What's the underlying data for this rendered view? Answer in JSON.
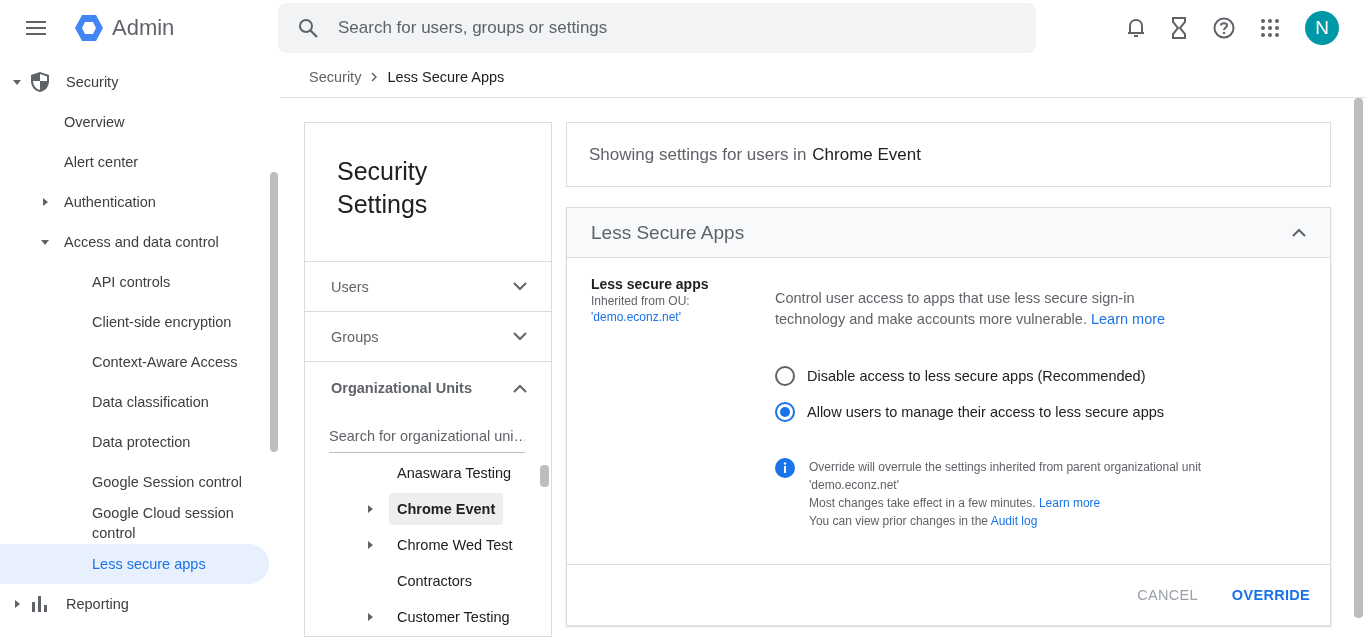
{
  "header": {
    "app_name": "Admin",
    "search": {
      "placeholder": "Search for users, groups or settings"
    },
    "avatar": "N"
  },
  "sidebar": {
    "items": [
      {
        "label": "Security",
        "expanded": true,
        "kind": "shield",
        "children": [
          {
            "label": "Overview",
            "selected": false
          },
          {
            "label": "Alert center",
            "selected": false
          },
          {
            "label": "Authentication",
            "expanded": false,
            "selected": false
          },
          {
            "label": "Access and data control",
            "expanded": true,
            "selected": false,
            "children": [
              {
                "label": "API controls",
                "selected": false
              },
              {
                "label": "Client-side encryption",
                "selected": false
              },
              {
                "label": "Context-Aware Access",
                "selected": false
              },
              {
                "label": "Data classification",
                "selected": false
              },
              {
                "label": "Data protection",
                "selected": false
              },
              {
                "label": "Google Session control",
                "selected": false
              },
              {
                "label": "Google Cloud session control",
                "selected": false
              },
              {
                "label": "Less secure apps",
                "selected": true
              }
            ]
          }
        ],
        "selected": false
      },
      {
        "label": "Reporting",
        "expanded": false,
        "kind": "chart",
        "selected": false
      }
    ]
  },
  "breadcrumb": [
    "Security",
    "Less Secure Apps"
  ],
  "settings_panel": {
    "title": "Security Settings",
    "sections": [
      {
        "label": "Users",
        "expanded": false
      },
      {
        "label": "Groups",
        "expanded": false
      },
      {
        "label": "Organizational Units",
        "expanded": true
      }
    ],
    "ou_search": {
      "placeholder": "Search for organizational uni…"
    },
    "ou_tree": [
      {
        "label": "Anaswara Testing",
        "selected": false
      },
      {
        "label": "Chrome Event",
        "expanded": false,
        "selected": true
      },
      {
        "label": "Chrome Wed Test",
        "expanded": false,
        "selected": false
      },
      {
        "label": "Contractors",
        "selected": false
      },
      {
        "label": "Customer Testing",
        "expanded": false,
        "selected": false
      }
    ]
  },
  "showing": {
    "prefix": "Showing settings for users in",
    "unit": "Chrome Event"
  },
  "card": {
    "title": "Less Secure Apps",
    "expanded": true,
    "setting_name": "Less secure apps",
    "inherited_label": "Inherited from OU:",
    "inherited_link": "'demo.econz.net'",
    "description": "Control user access to apps that use less secure sign-in technology and make accounts more vulnerable.",
    "description_link": "Learn more",
    "options": [
      {
        "label": "Disable access to less secure apps (Recommended)",
        "selected": false
      },
      {
        "label": "Allow users to manage their access to less secure apps",
        "selected": true
      }
    ],
    "info_lines": [
      {
        "text": "Override will overrule the settings inherited from parent organizational unit 'demo.econz.net'"
      },
      {
        "text": "Most changes take effect in a few minutes.",
        "link": "Learn more"
      },
      {
        "text": "You can view prior changes in the",
        "link": "Audit log"
      }
    ],
    "buttons": [
      {
        "label": "CANCEL",
        "disabled": true
      },
      {
        "label": "OVERRIDE",
        "disabled": false
      }
    ]
  }
}
